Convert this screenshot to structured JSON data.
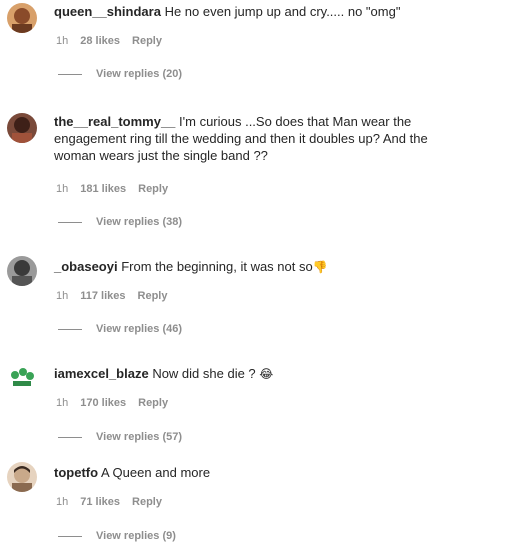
{
  "comments": [
    {
      "username": "queen__shindara",
      "text": "He no even jump up and cry..... no \"omg\"",
      "time": "1h",
      "likes": "28 likes",
      "reply": "Reply",
      "view_replies": "View replies (20)",
      "avatar_color": "#8a4b2a"
    },
    {
      "username": "the__real_tommy__",
      "text": "I'm curious ...So does that Man wear the engagement ring till the wedding and then it doubles up? And the woman wears just the single band ??",
      "time": "1h",
      "likes": "181 likes",
      "reply": "Reply",
      "view_replies": "View replies (38)",
      "avatar_color": "#5a2e22"
    },
    {
      "username": "_obaseoyi",
      "text": "From the beginning, it was not so",
      "emoji": "👎",
      "time": "1h",
      "likes": "117 likes",
      "reply": "Reply",
      "view_replies": "View replies (46)",
      "avatar_color": "#4a4a4a"
    },
    {
      "username": "iamexcel_blaze",
      "text": "Now did she die ?",
      "emoji": "😂",
      "time": "1h",
      "likes": "170 likes",
      "reply": "Reply",
      "view_replies": "View replies (57)",
      "avatar_color": "#3aa356"
    },
    {
      "username": "topetfo",
      "text": "A Queen and more",
      "time": "1h",
      "likes": "71 likes",
      "reply": "Reply",
      "view_replies": "View replies (9)",
      "avatar_color": "#c9a98a"
    }
  ]
}
